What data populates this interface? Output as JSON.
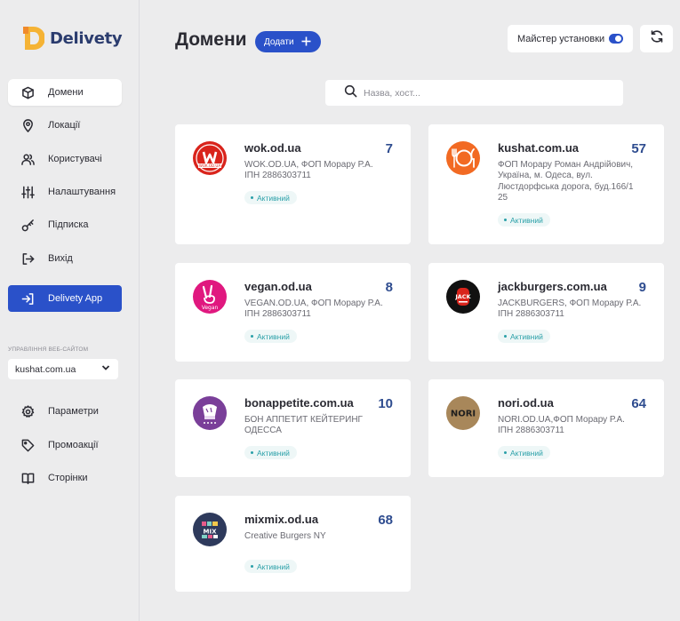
{
  "app": {
    "name": "Delivety"
  },
  "sidebar": {
    "items": [
      {
        "label": "Домени",
        "icon": "cube-icon"
      },
      {
        "label": "Локації",
        "icon": "map-pin-icon"
      },
      {
        "label": "Користувачі",
        "icon": "users-icon"
      },
      {
        "label": "Налаштування",
        "icon": "sliders-icon"
      },
      {
        "label": "Підписка",
        "icon": "key-icon"
      },
      {
        "label": "Вихід",
        "icon": "logout-icon"
      }
    ],
    "app_button": {
      "label": "Delivety App",
      "icon": "login-icon"
    },
    "site_section_label": "УПРАВЛІННЯ ВЕБ-САЙТОМ",
    "site_select_value": "kushat.com.ua",
    "site_items": [
      {
        "label": "Параметри",
        "icon": "gear-icon"
      },
      {
        "label": "Промоакції",
        "icon": "tag-icon"
      },
      {
        "label": "Сторінки",
        "icon": "book-icon"
      }
    ]
  },
  "header": {
    "title": "Домени",
    "add_label": "Додати",
    "wizard_label": "Майстер установки",
    "wizard_enabled": true
  },
  "search": {
    "placeholder": "Назва, хост..."
  },
  "domains": [
    {
      "domain": "wok.od.ua",
      "count": "7",
      "description": "WOK.OD.UA, ФОП Морару Р.А. ІПН 2886303711",
      "status": "Активний",
      "logo_color": "#d9241c",
      "logo_text": "WOK.OD.UA"
    },
    {
      "domain": "kushat.com.ua",
      "count": "57",
      "description": "ФОП Морару Роман Андрійович, Україна, м. Одеса, вул. Люстдорфська дорога, буд.166/1 25",
      "status": "Активний",
      "logo_color": "#f26a23",
      "logo_text": ""
    },
    {
      "domain": "vegan.od.ua",
      "count": "8",
      "description": "VEGAN.OD.UA, ФОП Морару Р.А. ІПН 2886303711",
      "status": "Активний",
      "logo_color": "#e0187f",
      "logo_text": "Vegan"
    },
    {
      "domain": "jackburgers.com.ua",
      "count": "9",
      "description": "JACKBURGERS, ФОП Морару Р.А. ІПН 2886303711",
      "status": "Активний",
      "logo_color": "#111111",
      "logo_text": "JACK"
    },
    {
      "domain": "bonappetite.com.ua",
      "count": "10",
      "description": "БОН АППЕТИТ КЕЙТЕРИНГ ОДЕССА",
      "status": "Активний",
      "logo_color": "#7a3f99",
      "logo_text": ""
    },
    {
      "domain": "nori.od.ua",
      "count": "64",
      "description": "NORI.OD.UA,ФОП Морару Р.А. ІПН 2886303711",
      "status": "Активний",
      "logo_color": "#a8875a",
      "logo_text": "NORI"
    },
    {
      "domain": "mixmix.od.ua",
      "count": "68",
      "description": "Creative Burgers NY",
      "status": "Активний",
      "logo_color": "#2e3a5c",
      "logo_text": "MIX"
    }
  ],
  "colors": {
    "accent": "#2a51c9",
    "count": "#2e4c8f",
    "status": "#2aa0a8",
    "background": "#ececed"
  }
}
